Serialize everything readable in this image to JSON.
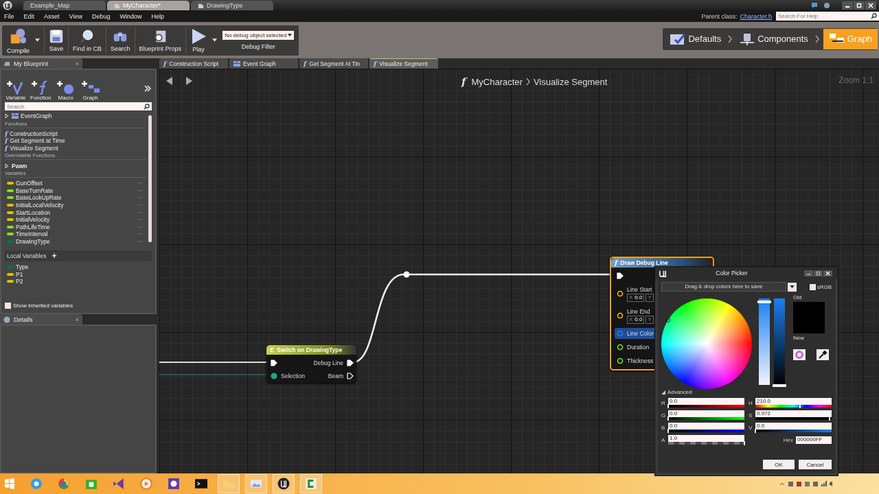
{
  "window_tabs": [
    {
      "label": "Example_Map",
      "selected": false
    },
    {
      "label": "MyCharacter*",
      "selected": true
    },
    {
      "label": "DrawingType",
      "selected": false
    }
  ],
  "menu": [
    "File",
    "Edit",
    "Asset",
    "View",
    "Debug",
    "Window",
    "Help"
  ],
  "parent_class": {
    "label": "Parent class:",
    "value": "Character.h"
  },
  "help_search": {
    "placeholder": "Search For Help"
  },
  "toolbar": [
    {
      "kind": "compile",
      "label": "Compile"
    },
    {
      "kind": "save",
      "label": "Save"
    },
    {
      "kind": "find",
      "label": "Find in CB"
    },
    {
      "kind": "search",
      "label": "Search"
    },
    {
      "kind": "props",
      "label": "Blueprint Props"
    },
    {
      "kind": "play",
      "label": "Play"
    }
  ],
  "debug_filter": {
    "value": "No debug object selected",
    "label": "Debug Filter"
  },
  "modes": [
    {
      "label": "Defaults",
      "selected": false
    },
    {
      "label": "Components",
      "selected": false
    },
    {
      "label": "Graph",
      "selected": true
    }
  ],
  "my_blueprint": {
    "tab": "My Blueprint",
    "close": "×",
    "add_buttons": [
      {
        "kind": "variable",
        "label": "Variable"
      },
      {
        "kind": "function",
        "label": "Function"
      },
      {
        "kind": "macro",
        "label": "Macro"
      },
      {
        "kind": "graph",
        "label": "Graph"
      }
    ],
    "search": {
      "placeholder": "Search"
    },
    "rows": [
      {
        "kind": "graph",
        "label": "EventGraph",
        "expanded": false
      },
      {
        "kind": "heading",
        "label": "Functions"
      },
      {
        "kind": "construction",
        "icon": "f",
        "label": "ConstructionScript"
      },
      {
        "kind": "function",
        "icon": "f",
        "label": "Get Segment at Time"
      },
      {
        "kind": "function",
        "icon": "f",
        "label": "Visualize Segment"
      },
      {
        "kind": "heading",
        "label": "Overridable Functions"
      },
      {
        "kind": "category",
        "label": "Pawn",
        "expanded": false
      },
      {
        "kind": "heading",
        "label": "Variables"
      },
      {
        "kind": "variable",
        "label": "GunOffset",
        "color": "#e0c000"
      },
      {
        "kind": "variable",
        "label": "BaseTurnRate",
        "color": "#80e020"
      },
      {
        "kind": "variable",
        "label": "BaseLookUpRate",
        "color": "#80e020"
      },
      {
        "kind": "variable",
        "label": "InitialLocalVelocity",
        "color": "#e0c000"
      },
      {
        "kind": "variable",
        "label": "StartLocation",
        "color": "#e0c000"
      },
      {
        "kind": "variable",
        "label": "InitialVelocity",
        "color": "#e0c000"
      },
      {
        "kind": "variable",
        "label": "PathLifeTime",
        "color": "#80e020"
      },
      {
        "kind": "variable",
        "label": "TimeInterval",
        "color": "#80e020"
      },
      {
        "kind": "variable",
        "label": "DrawingType",
        "color": "#0a6e58"
      }
    ],
    "local_variables": {
      "label": "Local Variables",
      "add": "+",
      "items": [
        {
          "label": "Type",
          "color": "#0a6e58"
        },
        {
          "label": "P1",
          "color": "#e0c000"
        },
        {
          "label": "P2",
          "color": "#e0c000"
        }
      ]
    },
    "show_inherited": {
      "label": "Show inherited variables",
      "checked": false
    }
  },
  "details_tab": {
    "label": "Details",
    "close": "×"
  },
  "graph_tabs": [
    {
      "label": "Construction Script",
      "kind": "function",
      "icon": "f",
      "selected": false
    },
    {
      "label": "Event Graph",
      "kind": "graph",
      "selected": false
    },
    {
      "label": "Get Segment At Tin",
      "kind": "function",
      "icon": "f",
      "selected": false
    },
    {
      "label": "Visualize Segment",
      "kind": "function",
      "icon": "f",
      "selected": true
    }
  ],
  "breadcrumb": {
    "icon": "f",
    "owner": "MyCharacter",
    "function": "Visualize Segment"
  },
  "zoom": "Zoom 1:1",
  "switch_node": {
    "icon": "E",
    "title": "Switch on DrawingType",
    "inputs": [
      {
        "kind": "exec",
        "connected": true
      },
      {
        "kind": "byte",
        "label": "Selection",
        "connected": true
      }
    ],
    "outputs": [
      {
        "kind": "exec",
        "label": "Debug Line",
        "connected": true
      },
      {
        "kind": "exec",
        "label": "Beam",
        "connected": false
      }
    ]
  },
  "draw_node": {
    "icon": "f",
    "title": "Draw Debug Line",
    "pins": [
      {
        "kind": "exec",
        "connected": true,
        "highlighted": false
      },
      {
        "kind": "struct",
        "label": "Line Start",
        "connected": false,
        "highlighted": false,
        "fields": [
          {
            "label": "X",
            "value": "0.0"
          },
          {
            "label": "Y"
          }
        ]
      },
      {
        "kind": "struct",
        "label": "Line End",
        "connected": false,
        "highlighted": false,
        "fields": [
          {
            "label": "X",
            "value": "0.0"
          },
          {
            "label": "Y"
          }
        ]
      },
      {
        "kind": "color",
        "label": "Line Color",
        "connected": false,
        "highlighted": true
      },
      {
        "kind": "float",
        "label": "Duration",
        "connected": false,
        "highlighted": false
      },
      {
        "kind": "float",
        "label": "Thickness",
        "connected": false,
        "highlighted": false
      }
    ]
  },
  "color_picker": {
    "title": "Color Picker",
    "swatch_hint": "Drag & drop colors here to save",
    "srgb": {
      "label": "sRGB",
      "checked": false
    },
    "saturation_bar": {
      "level": 0.972
    },
    "value_bar": {
      "level": 0
    },
    "old_label": "Old",
    "new_label": "New",
    "advanced": {
      "label": "Advanced",
      "expanded": true
    },
    "left_fields": [
      {
        "label": "R",
        "value": "0.0",
        "kind": "red",
        "level": 0
      },
      {
        "label": "G",
        "value": "0.0",
        "kind": "green",
        "level": 0
      },
      {
        "label": "B",
        "value": "0.0",
        "kind": "blue",
        "level": 0
      },
      {
        "label": "A",
        "value": "1.0",
        "kind": "alpha",
        "level": 1
      }
    ],
    "right_fields": [
      {
        "label": "H",
        "value": "210.0",
        "kind": "hue",
        "level": 0.583
      },
      {
        "label": "S",
        "value": "0.972",
        "kind": "saturation",
        "level": 0.972
      },
      {
        "label": "V",
        "value": "0.0",
        "kind": "value",
        "level": 0
      }
    ],
    "hex": {
      "label": "Hex",
      "value": "000000FF"
    },
    "buttons": [
      "OK",
      "Cancel"
    ]
  }
}
